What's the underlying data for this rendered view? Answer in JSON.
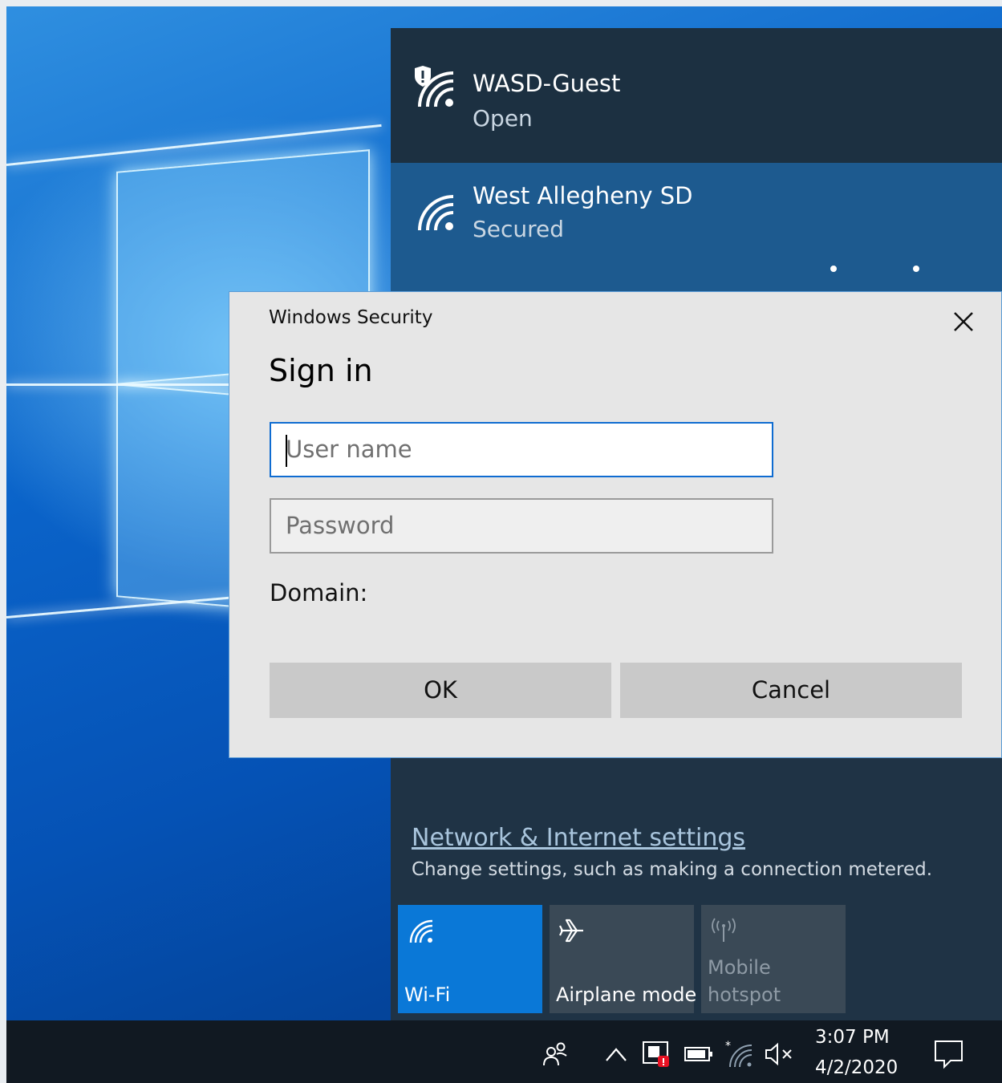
{
  "networks": [
    {
      "name": "WASD-Guest",
      "status": "Open",
      "icon": "wifi-shield-icon"
    },
    {
      "name": "West Allegheny SD",
      "status": "Secured",
      "icon": "wifi-icon"
    }
  ],
  "network_settings": {
    "link": "Network & Internet settings",
    "description": "Change settings, such as making a connection metered."
  },
  "quick_actions": [
    {
      "label": "Wi-Fi",
      "icon": "wifi-icon",
      "active": true
    },
    {
      "label": "Airplane mode",
      "icon": "airplane-icon",
      "active": false
    },
    {
      "label": "Mobile\nhotspot",
      "icon": "hotspot-icon",
      "active": false
    }
  ],
  "dialog": {
    "window_title": "Windows Security",
    "heading": "Sign in",
    "username_placeholder": "User name",
    "password_placeholder": "Password",
    "domain_label": "Domain:",
    "ok_label": "OK",
    "cancel_label": "Cancel"
  },
  "taskbar": {
    "time": "3:07 PM",
    "date": "4/2/2020",
    "tray_icons": [
      "people-icon",
      "chevron-up-icon",
      "security-center-icon",
      "battery-icon",
      "wifi-icon",
      "volume-muted-icon",
      "notification-icon"
    ]
  },
  "colors": {
    "accent": "#0a78d7",
    "dialog_border": "#5b9bd5",
    "flyout_bg": "#1f3345",
    "selected_network_bg": "#1d5a8f"
  }
}
